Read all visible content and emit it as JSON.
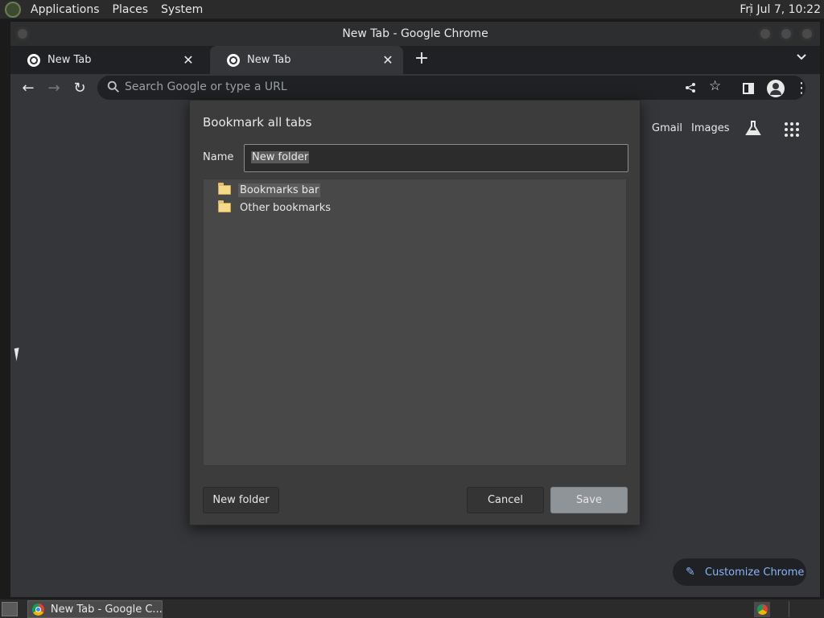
{
  "system_panel": {
    "menus": [
      "Applications",
      "Places",
      "System"
    ],
    "clock": "Fri Jul  7, 10:22"
  },
  "window": {
    "title": "New Tab - Google Chrome"
  },
  "tabs": [
    {
      "title": "New Tab",
      "close": "✕"
    },
    {
      "title": "New Tab",
      "close": "✕"
    }
  ],
  "tabstrip": {
    "new_tab_icon": "+",
    "tab_search_icon": "chevron-down-icon"
  },
  "toolbar": {
    "back_icon": "←",
    "forward_icon": "→",
    "reload_icon": "↻",
    "omnibox_placeholder": "Search Google or type a URL",
    "share_icon": "share-icon",
    "bookmark_star": "☆",
    "side_panel_icon": "side-panel-icon",
    "profile_icon": "profile-icon",
    "menu_icon": "⋮"
  },
  "ntp": {
    "gmail": "Gmail",
    "images": "Images",
    "labs_icon": "labs-icon",
    "apps_icon": "apps-icon",
    "customize": "Customize Chrome"
  },
  "dialog": {
    "title": "Bookmark all tabs",
    "name_label": "Name",
    "name_value": "New folder",
    "folders": [
      {
        "label": "Bookmarks bar",
        "selected": true
      },
      {
        "label": "Other bookmarks",
        "selected": false
      }
    ],
    "new_folder_button": "New folder",
    "cancel_button": "Cancel",
    "save_button": "Save"
  },
  "taskbar": {
    "task_label": "New Tab - Google C..."
  },
  "colors": {
    "accent_link": "#8ab4f8",
    "save_button_bg": "#8f9499",
    "folder_yellow": "#f5d98a"
  }
}
